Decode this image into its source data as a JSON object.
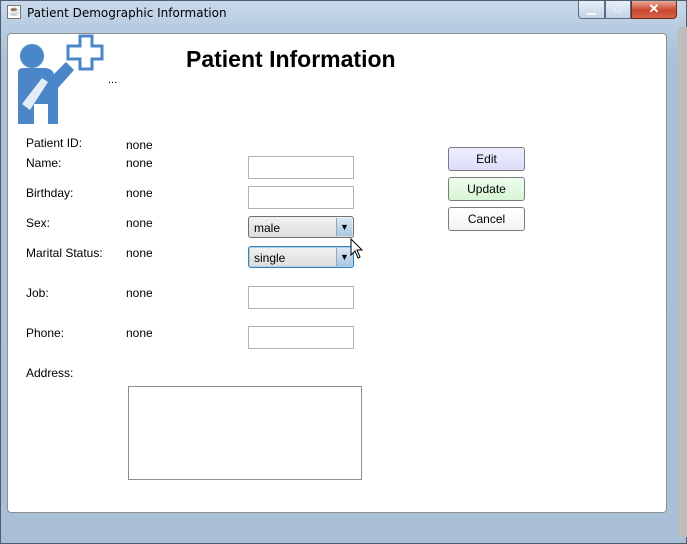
{
  "window": {
    "title": "Patient Demographic Information",
    "app_icon": "java-icon",
    "controls": {
      "minimize": "minimize-icon",
      "maximize": "maximize-icon",
      "close": "✕"
    }
  },
  "header": {
    "title": "Patient Information",
    "logo": "patient-medical-cross-icon",
    "ellipsis": "..."
  },
  "form": {
    "patient_id": {
      "label": "Patient ID:",
      "value": "none"
    },
    "name": {
      "label": "Name:",
      "value": "none",
      "input": ""
    },
    "birthday": {
      "label": "Birthday:",
      "value": "none",
      "input": ""
    },
    "sex": {
      "label": "Sex:",
      "value": "none",
      "selected": "male"
    },
    "marital_status": {
      "label": "Marital Status:",
      "value": "none",
      "selected": "single"
    },
    "job": {
      "label": "Job:",
      "value": "none",
      "input": ""
    },
    "phone": {
      "label": "Phone:",
      "value": "none",
      "input": ""
    },
    "address": {
      "label": "Address:",
      "input": ""
    }
  },
  "buttons": {
    "edit": "Edit",
    "update": "Update",
    "cancel": "Cancel"
  },
  "colors": {
    "edit_bg": "#dcdcf8",
    "update_bg": "#d6f5d6",
    "logo_blue": "#4a86c8"
  }
}
